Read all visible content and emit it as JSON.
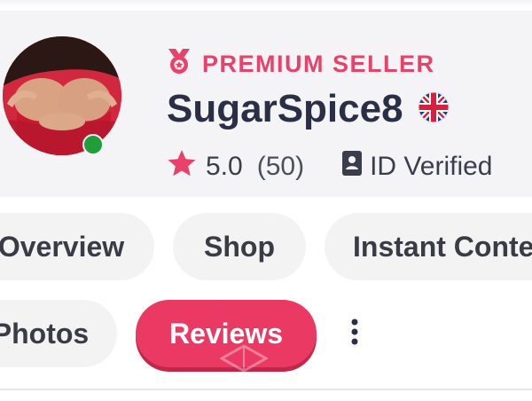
{
  "seller": {
    "badge_label": "PREMIUM SELLER",
    "name": "SugarSpice8",
    "rating": "5.0",
    "review_count": "(50)",
    "verification": "ID Verified",
    "online": true
  },
  "tabs": [
    {
      "label": "Overview",
      "active": false
    },
    {
      "label": "Shop",
      "active": false
    },
    {
      "label": "Instant Content",
      "active": false
    },
    {
      "label": "Photos",
      "active": false
    },
    {
      "label": "Reviews",
      "active": true
    }
  ],
  "colors": {
    "accent": "#ea3a63",
    "badge": "#e8426a",
    "name": "#2a2f45",
    "online": "#1f9e3a",
    "card_bg": "#f4f4f6"
  },
  "icons": {
    "badge": "ribbon-medal-icon",
    "flag": "uk-flag-icon",
    "rating": "star-icon",
    "verification": "id-card-icon",
    "more": "vertical-dots-icon"
  }
}
